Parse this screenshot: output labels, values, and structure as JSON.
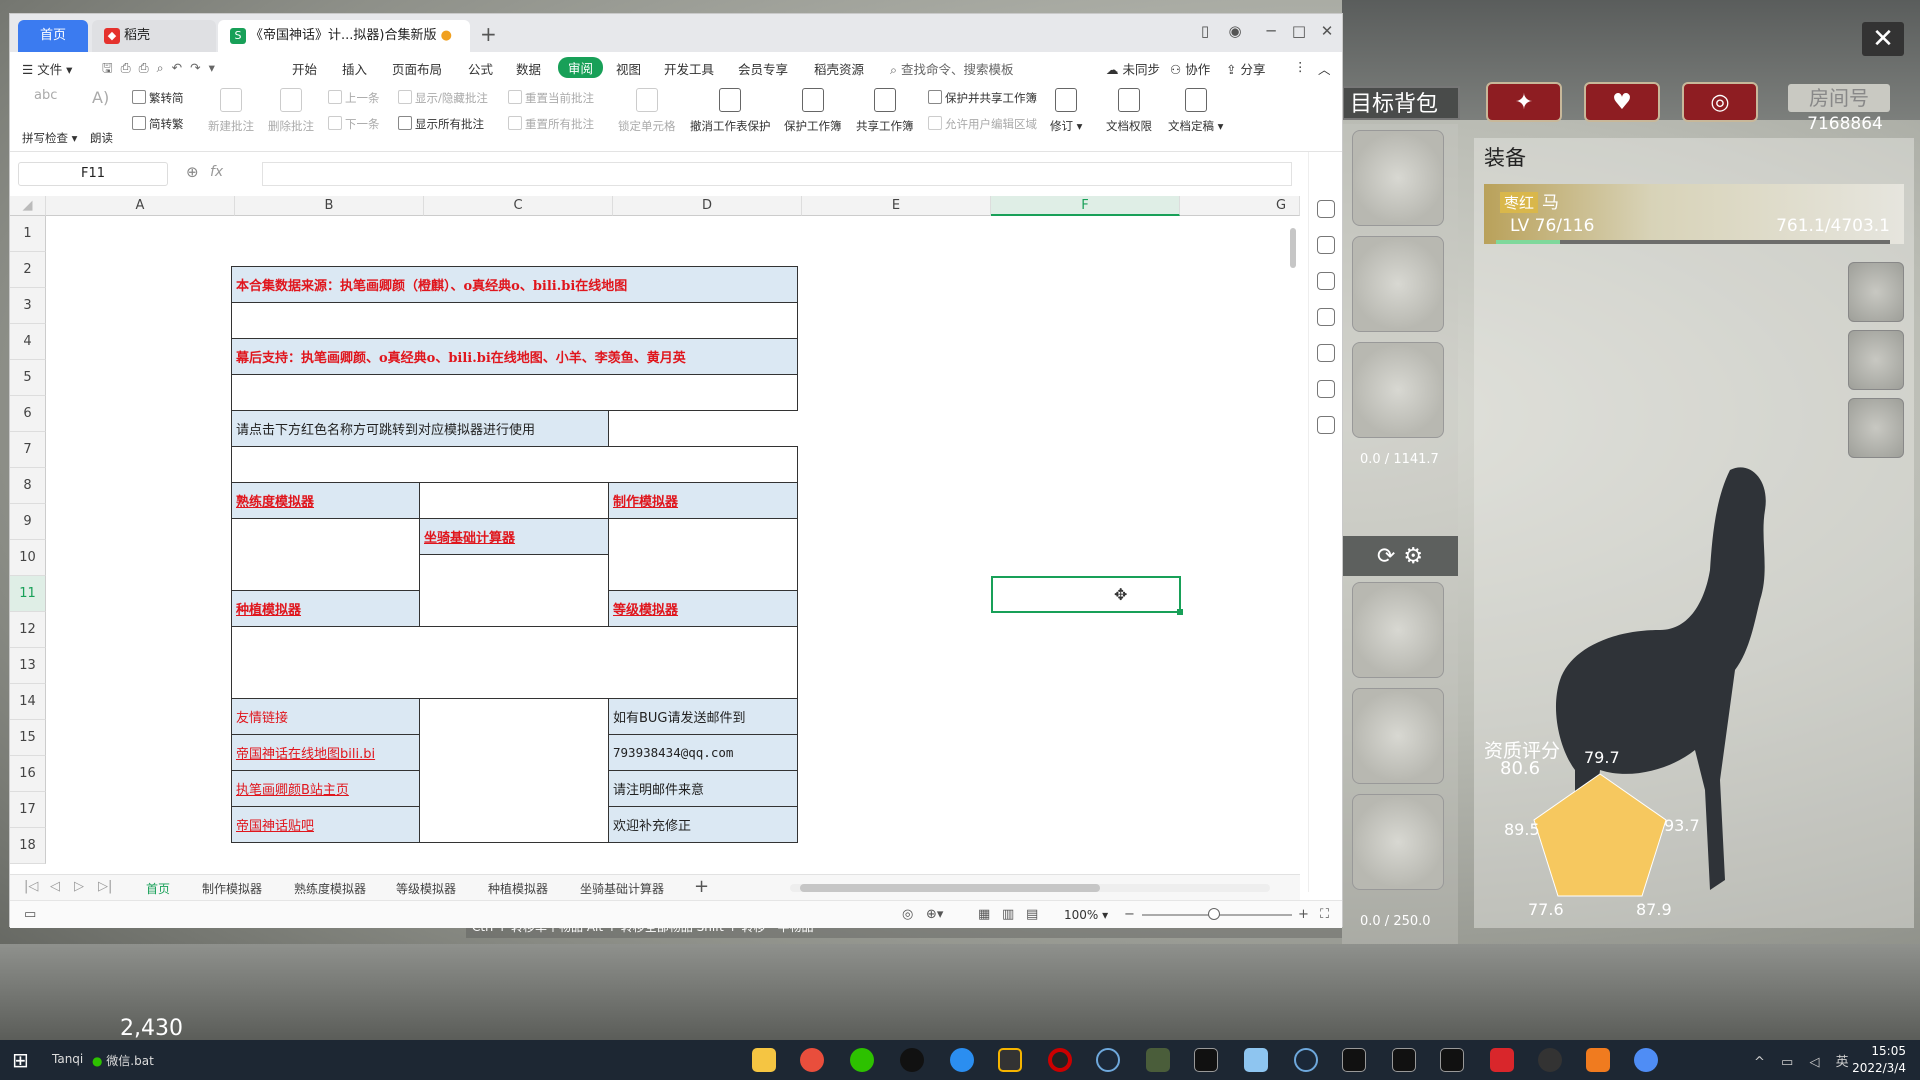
{
  "game": {
    "bag_title": "目标背包",
    "room_label": "房间号",
    "room_number": "7168864",
    "close": "✕",
    "tab_icons": [
      "✦",
      "♥",
      "◎"
    ],
    "equip_title": "装备",
    "horse_tag": "枣红",
    "horse_name": "马",
    "horse_level": "LV 76/116",
    "horse_exp": "761.1/4703.1",
    "exp_fraction": 0.162,
    "bag_weight_top": "0.0 / 1141.7",
    "bag_weight_bottom": "0.0 / 250.0",
    "aptitude_label": "资质评分",
    "aptitude_value": "80.6",
    "radar_values": [
      "79.7",
      "93.7",
      "87.9",
      "77.6",
      "89.5"
    ],
    "hint_bar": "Ctrl + 转移单个物品    Alt + 转移全部物品    Shift + 转移一半物品",
    "gold": "2,430"
  },
  "window": {
    "tab_home": "首页",
    "tab_shell": "稻壳",
    "tab_doc": "《帝国神话》计...拟器)合集新版",
    "tab_add": "+"
  },
  "menu": {
    "file": "文件",
    "items": [
      "开始",
      "插入",
      "页面布局",
      "公式",
      "数据",
      "审阅",
      "视图",
      "开发工具",
      "会员专享",
      "稻壳资源"
    ],
    "search": "查找命令、搜索模板",
    "sync": "未同步",
    "collab": "协作",
    "share": "分享"
  },
  "ribbon": {
    "spell": "拼写检查",
    "read": "朗读",
    "to_trad": "繁转简",
    "to_simp": "简转繁",
    "new_comment": "新建批注",
    "del_comment": "删除批注",
    "prev": "上一条",
    "next": "下一条",
    "toggle_comment": "显示/隐藏批注",
    "show_all_comments": "显示所有批注",
    "reset_comment": "重置当前批注",
    "reset_all": "重置所有批注",
    "lock_cell": "锁定单元格",
    "unprotect_sheet": "撤消工作表保护",
    "protect_book": "保护工作簿",
    "share_book": "共享工作簿",
    "protect_share": "保护并共享工作簿",
    "allow_edit": "允许用户编辑区域",
    "revise": "修订",
    "doc_perm": "文档权限",
    "doc_final": "文档定稿"
  },
  "formula": {
    "namebox": "F11",
    "fx": "fx"
  },
  "columns": [
    "A",
    "B",
    "C",
    "D",
    "E",
    "F",
    "G"
  ],
  "rows": [
    "1",
    "2",
    "3",
    "4",
    "5",
    "6",
    "7",
    "8",
    "9",
    "10",
    "11",
    "12",
    "13",
    "14",
    "15",
    "16",
    "17",
    "18"
  ],
  "cells": {
    "source": "本合集数据来源：执笔画卿颜（橙麒）、o真经典o、bili.bi在线地图",
    "thanks": "幕后支持：执笔画卿颜、o真经典o、bili.bi在线地图、小羊、李羡鱼、黄月英",
    "instruction": "请点击下方红色名称方可跳转到对应模拟器进行使用",
    "proficiency": "熟练度模拟器",
    "craft": "制作模拟器",
    "mount": "坐骑基础计算器",
    "plant": "种植模拟器",
    "level": "等级模拟器",
    "friend_links": "友情链接",
    "map_link": "帝国神话在线地图bili.bi",
    "author_page": "执笔画卿颜B站主页",
    "tieba": "帝国神话贴吧",
    "bug_report": "如有BUG请发送邮件到",
    "email": "793938434@qq.com",
    "note_intent": "请注明邮件来意",
    "welcome": "欢迎补充修正"
  },
  "sheets": [
    "首页",
    "制作模拟器",
    "熟练度模拟器",
    "等级模拟器",
    "种植模拟器",
    "坐骑基础计算器"
  ],
  "status": {
    "zoom": "100%"
  },
  "taskbar": {
    "user": "Tanqi",
    "wechat": "微信.bat",
    "time": "15:05",
    "date": "2022/3/4"
  }
}
